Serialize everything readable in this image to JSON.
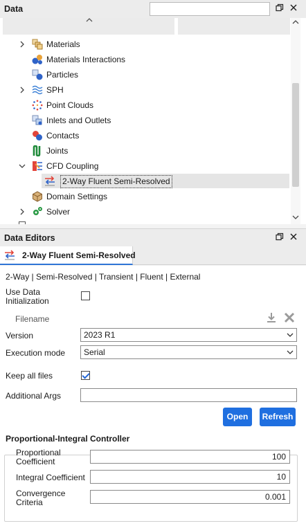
{
  "data_panel": {
    "title": "Data",
    "search": {
      "value": "",
      "placeholder": ""
    },
    "items": [
      {
        "label": "Materials",
        "expandable": true,
        "expanded": false
      },
      {
        "label": "Materials Interactions",
        "expandable": false
      },
      {
        "label": "Particles",
        "expandable": false
      },
      {
        "label": "SPH",
        "expandable": true,
        "expanded": false
      },
      {
        "label": "Point Clouds",
        "expandable": false
      },
      {
        "label": "Inlets and Outlets",
        "expandable": false
      },
      {
        "label": "Contacts",
        "expandable": false
      },
      {
        "label": "Joints",
        "expandable": false
      },
      {
        "label": "CFD Coupling",
        "expandable": true,
        "expanded": true
      },
      {
        "label": "2-Way Fluent Semi-Resolved",
        "selected": true,
        "child": true
      },
      {
        "label": "Domain Settings",
        "expandable": false
      },
      {
        "label": "Solver",
        "expandable": true,
        "expanded": false
      }
    ]
  },
  "editors_panel": {
    "title": "Data Editors",
    "tab_label": "2-Way Fluent Semi-Resolved",
    "summary": "2-Way | Semi-Resolved | Transient | Fluent | External",
    "use_data_initialization": {
      "label": "Use Data Initialization",
      "label_line1": "Use Data",
      "label_line2": "Initialization",
      "checked": false
    },
    "filename_label": "Filename",
    "version": {
      "label": "Version",
      "value": "2023 R1"
    },
    "execution_mode": {
      "label": "Execution mode",
      "value": "Serial"
    },
    "keep_all_files": {
      "label": "Keep all files",
      "checked": true
    },
    "additional_args": {
      "label": "Additional Args",
      "value": ""
    },
    "open_label": "Open",
    "refresh_label": "Refresh",
    "pi_controller": {
      "title": "Proportional-Integral Controller",
      "proportional": {
        "label_line1": "Proportional",
        "label_line2": "Coefficient",
        "value": "100"
      },
      "integral": {
        "label": "Integral Coefficient",
        "value": "10"
      },
      "convergence": {
        "label_line1": "Convergence",
        "label_line2": "Criteria",
        "value": "0.001"
      }
    }
  },
  "colors": {
    "accent": "#1f6fe0",
    "selection": "#e5e5e5",
    "panel_bg": "#ececec"
  }
}
